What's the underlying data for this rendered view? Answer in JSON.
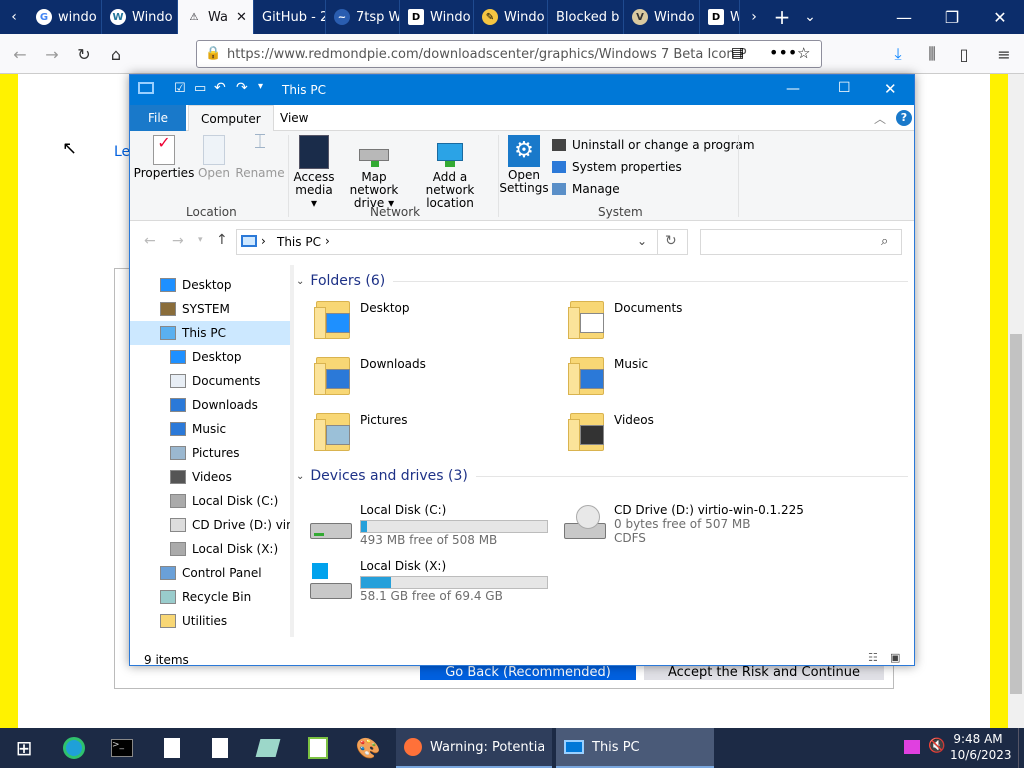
{
  "browser": {
    "tabs": [
      {
        "label": "windo",
        "icon": "google-icon"
      },
      {
        "label": "Windo",
        "icon": "wordpress-icon"
      },
      {
        "label": "Wa",
        "icon": "warning-icon",
        "active": true
      },
      {
        "label": "GitHub - 2",
        "icon": "github-icon"
      },
      {
        "label": "7tsp W",
        "icon": "7tsp-icon"
      },
      {
        "label": "Windo",
        "icon": "deskmodder-icon"
      },
      {
        "label": "Windo",
        "icon": "pencil-icon"
      },
      {
        "label": "Blocked b",
        "icon": "blocked-icon"
      },
      {
        "label": "Windo",
        "icon": "v-icon"
      },
      {
        "label": "W",
        "icon": "deskmodder-icon"
      }
    ],
    "url": "https://www.redmondpie.com/downloadscenter/graphics/Windows 7 Beta Icon P",
    "page_link_fragment": "Le",
    "page_buttons": {
      "go_back": "Go Back (Recommended)",
      "accept": "Accept the Risk and Continue"
    }
  },
  "explorer": {
    "title": "This PC",
    "ribbon_tabs": [
      "File",
      "Computer",
      "View"
    ],
    "location_group": {
      "label": "Location",
      "buttons": [
        "Properties",
        "Open",
        "Rename"
      ]
    },
    "network_group": {
      "label": "Network",
      "access_media": [
        "Access",
        "media ▾"
      ],
      "map_drive": [
        "Map network",
        "drive ▾"
      ],
      "add_location": [
        "Add a network",
        "location"
      ]
    },
    "system_group": {
      "label": "System",
      "open_settings": [
        "Open",
        "Settings"
      ],
      "items": [
        "Uninstall or change a program",
        "System properties",
        "Manage"
      ]
    },
    "address": {
      "path": "This PC",
      "separator": "›"
    },
    "nav": [
      {
        "label": "Desktop",
        "indent": 0,
        "icon": "desktop-icon"
      },
      {
        "label": "SYSTEM",
        "indent": 0,
        "icon": "user-icon"
      },
      {
        "label": "This PC",
        "indent": 0,
        "icon": "computer-icon",
        "selected": true
      },
      {
        "label": "Desktop",
        "indent": 1,
        "icon": "desktop-icon"
      },
      {
        "label": "Documents",
        "indent": 1,
        "icon": "documents-icon"
      },
      {
        "label": "Downloads",
        "indent": 1,
        "icon": "downloads-icon"
      },
      {
        "label": "Music",
        "indent": 1,
        "icon": "music-icon"
      },
      {
        "label": "Pictures",
        "indent": 1,
        "icon": "pictures-icon"
      },
      {
        "label": "Videos",
        "indent": 1,
        "icon": "videos-icon"
      },
      {
        "label": "Local Disk (C:)",
        "indent": 1,
        "icon": "disk-icon"
      },
      {
        "label": "CD Drive (D:) virtic",
        "indent": 1,
        "icon": "cd-icon"
      },
      {
        "label": "Local Disk (X:)",
        "indent": 1,
        "icon": "disk-icon"
      },
      {
        "label": "Control Panel",
        "indent": 0,
        "icon": "control-panel-icon"
      },
      {
        "label": "Recycle Bin",
        "indent": 0,
        "icon": "recycle-bin-icon"
      },
      {
        "label": "Utilities",
        "indent": 0,
        "icon": "folder-icon"
      }
    ],
    "folders_header": "Folders (6)",
    "folders": [
      "Desktop",
      "Documents",
      "Downloads",
      "Music",
      "Pictures",
      "Videos"
    ],
    "devices_header": "Devices and drives (3)",
    "drives": [
      {
        "name": "Local Disk (C:)",
        "free": "493 MB free of 508 MB",
        "used_fraction": 0.03
      },
      {
        "name": "Local Disk (X:)",
        "free": "58.1 GB free of 69.4 GB",
        "used_fraction": 0.16
      }
    ],
    "cd_drive": {
      "name": "CD Drive (D:) virtio-win-0.1.225",
      "free": "0 bytes free of 507 MB",
      "fs": "CDFS"
    },
    "status": "9 items"
  },
  "taskbar": {
    "windows": [
      "Warning: Potential ...",
      "This PC"
    ],
    "time": "9:48 AM",
    "date": "10/6/2023"
  }
}
